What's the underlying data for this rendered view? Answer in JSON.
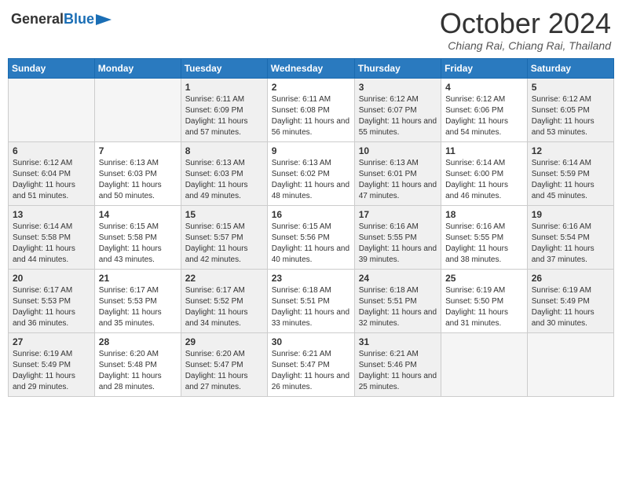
{
  "header": {
    "logo_general": "General",
    "logo_blue": "Blue",
    "month_year": "October 2024",
    "location": "Chiang Rai, Chiang Rai, Thailand"
  },
  "days_of_week": [
    "Sunday",
    "Monday",
    "Tuesday",
    "Wednesday",
    "Thursday",
    "Friday",
    "Saturday"
  ],
  "weeks": [
    [
      {
        "day": "",
        "sunrise": "",
        "sunset": "",
        "daylight": ""
      },
      {
        "day": "",
        "sunrise": "",
        "sunset": "",
        "daylight": ""
      },
      {
        "day": "1",
        "sunrise": "Sunrise: 6:11 AM",
        "sunset": "Sunset: 6:09 PM",
        "daylight": "Daylight: 11 hours and 57 minutes."
      },
      {
        "day": "2",
        "sunrise": "Sunrise: 6:11 AM",
        "sunset": "Sunset: 6:08 PM",
        "daylight": "Daylight: 11 hours and 56 minutes."
      },
      {
        "day": "3",
        "sunrise": "Sunrise: 6:12 AM",
        "sunset": "Sunset: 6:07 PM",
        "daylight": "Daylight: 11 hours and 55 minutes."
      },
      {
        "day": "4",
        "sunrise": "Sunrise: 6:12 AM",
        "sunset": "Sunset: 6:06 PM",
        "daylight": "Daylight: 11 hours and 54 minutes."
      },
      {
        "day": "5",
        "sunrise": "Sunrise: 6:12 AM",
        "sunset": "Sunset: 6:05 PM",
        "daylight": "Daylight: 11 hours and 53 minutes."
      }
    ],
    [
      {
        "day": "6",
        "sunrise": "Sunrise: 6:12 AM",
        "sunset": "Sunset: 6:04 PM",
        "daylight": "Daylight: 11 hours and 51 minutes."
      },
      {
        "day": "7",
        "sunrise": "Sunrise: 6:13 AM",
        "sunset": "Sunset: 6:03 PM",
        "daylight": "Daylight: 11 hours and 50 minutes."
      },
      {
        "day": "8",
        "sunrise": "Sunrise: 6:13 AM",
        "sunset": "Sunset: 6:03 PM",
        "daylight": "Daylight: 11 hours and 49 minutes."
      },
      {
        "day": "9",
        "sunrise": "Sunrise: 6:13 AM",
        "sunset": "Sunset: 6:02 PM",
        "daylight": "Daylight: 11 hours and 48 minutes."
      },
      {
        "day": "10",
        "sunrise": "Sunrise: 6:13 AM",
        "sunset": "Sunset: 6:01 PM",
        "daylight": "Daylight: 11 hours and 47 minutes."
      },
      {
        "day": "11",
        "sunrise": "Sunrise: 6:14 AM",
        "sunset": "Sunset: 6:00 PM",
        "daylight": "Daylight: 11 hours and 46 minutes."
      },
      {
        "day": "12",
        "sunrise": "Sunrise: 6:14 AM",
        "sunset": "Sunset: 5:59 PM",
        "daylight": "Daylight: 11 hours and 45 minutes."
      }
    ],
    [
      {
        "day": "13",
        "sunrise": "Sunrise: 6:14 AM",
        "sunset": "Sunset: 5:58 PM",
        "daylight": "Daylight: 11 hours and 44 minutes."
      },
      {
        "day": "14",
        "sunrise": "Sunrise: 6:15 AM",
        "sunset": "Sunset: 5:58 PM",
        "daylight": "Daylight: 11 hours and 43 minutes."
      },
      {
        "day": "15",
        "sunrise": "Sunrise: 6:15 AM",
        "sunset": "Sunset: 5:57 PM",
        "daylight": "Daylight: 11 hours and 42 minutes."
      },
      {
        "day": "16",
        "sunrise": "Sunrise: 6:15 AM",
        "sunset": "Sunset: 5:56 PM",
        "daylight": "Daylight: 11 hours and 40 minutes."
      },
      {
        "day": "17",
        "sunrise": "Sunrise: 6:16 AM",
        "sunset": "Sunset: 5:55 PM",
        "daylight": "Daylight: 11 hours and 39 minutes."
      },
      {
        "day": "18",
        "sunrise": "Sunrise: 6:16 AM",
        "sunset": "Sunset: 5:55 PM",
        "daylight": "Daylight: 11 hours and 38 minutes."
      },
      {
        "day": "19",
        "sunrise": "Sunrise: 6:16 AM",
        "sunset": "Sunset: 5:54 PM",
        "daylight": "Daylight: 11 hours and 37 minutes."
      }
    ],
    [
      {
        "day": "20",
        "sunrise": "Sunrise: 6:17 AM",
        "sunset": "Sunset: 5:53 PM",
        "daylight": "Daylight: 11 hours and 36 minutes."
      },
      {
        "day": "21",
        "sunrise": "Sunrise: 6:17 AM",
        "sunset": "Sunset: 5:53 PM",
        "daylight": "Daylight: 11 hours and 35 minutes."
      },
      {
        "day": "22",
        "sunrise": "Sunrise: 6:17 AM",
        "sunset": "Sunset: 5:52 PM",
        "daylight": "Daylight: 11 hours and 34 minutes."
      },
      {
        "day": "23",
        "sunrise": "Sunrise: 6:18 AM",
        "sunset": "Sunset: 5:51 PM",
        "daylight": "Daylight: 11 hours and 33 minutes."
      },
      {
        "day": "24",
        "sunrise": "Sunrise: 6:18 AM",
        "sunset": "Sunset: 5:51 PM",
        "daylight": "Daylight: 11 hours and 32 minutes."
      },
      {
        "day": "25",
        "sunrise": "Sunrise: 6:19 AM",
        "sunset": "Sunset: 5:50 PM",
        "daylight": "Daylight: 11 hours and 31 minutes."
      },
      {
        "day": "26",
        "sunrise": "Sunrise: 6:19 AM",
        "sunset": "Sunset: 5:49 PM",
        "daylight": "Daylight: 11 hours and 30 minutes."
      }
    ],
    [
      {
        "day": "27",
        "sunrise": "Sunrise: 6:19 AM",
        "sunset": "Sunset: 5:49 PM",
        "daylight": "Daylight: 11 hours and 29 minutes."
      },
      {
        "day": "28",
        "sunrise": "Sunrise: 6:20 AM",
        "sunset": "Sunset: 5:48 PM",
        "daylight": "Daylight: 11 hours and 28 minutes."
      },
      {
        "day": "29",
        "sunrise": "Sunrise: 6:20 AM",
        "sunset": "Sunset: 5:47 PM",
        "daylight": "Daylight: 11 hours and 27 minutes."
      },
      {
        "day": "30",
        "sunrise": "Sunrise: 6:21 AM",
        "sunset": "Sunset: 5:47 PM",
        "daylight": "Daylight: 11 hours and 26 minutes."
      },
      {
        "day": "31",
        "sunrise": "Sunrise: 6:21 AM",
        "sunset": "Sunset: 5:46 PM",
        "daylight": "Daylight: 11 hours and 25 minutes."
      },
      {
        "day": "",
        "sunrise": "",
        "sunset": "",
        "daylight": ""
      },
      {
        "day": "",
        "sunrise": "",
        "sunset": "",
        "daylight": ""
      }
    ]
  ]
}
